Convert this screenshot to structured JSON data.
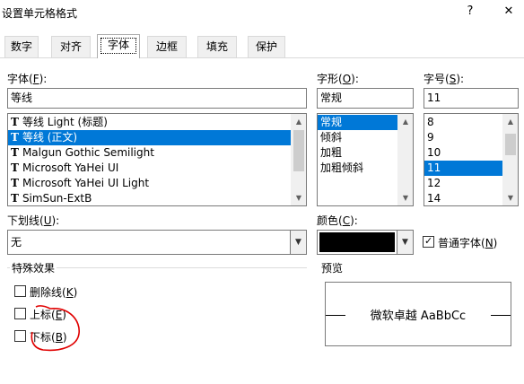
{
  "window": {
    "title": "设置单元格格式",
    "help_label": "?",
    "close_label": "✕"
  },
  "tabs": [
    {
      "label": "数字"
    },
    {
      "label": "对齐"
    },
    {
      "label": "字体"
    },
    {
      "label": "边框"
    },
    {
      "label": "填充"
    },
    {
      "label": "保护"
    }
  ],
  "font": {
    "label_text": "字体(",
    "label_key": "F",
    "label_end": "):",
    "value": "等线",
    "items": [
      {
        "glyph": "T",
        "label": "等线 Light (标题)",
        "selected": false
      },
      {
        "glyph": "T",
        "label": "等线 (正文)",
        "selected": true
      },
      {
        "glyph": "T",
        "label": "Malgun Gothic Semilight",
        "selected": false
      },
      {
        "glyph": "T",
        "label": "Microsoft YaHei UI",
        "selected": false
      },
      {
        "glyph": "T",
        "label": "Microsoft YaHei UI Light",
        "selected": false
      },
      {
        "glyph": "T",
        "label": "SimSun-ExtB",
        "selected": false
      }
    ]
  },
  "style": {
    "label_text": "字形(",
    "label_key": "O",
    "label_end": "):",
    "value": "常规",
    "items": [
      {
        "label": "常规",
        "selected": true
      },
      {
        "label": "倾斜",
        "selected": false
      },
      {
        "label": "加粗",
        "selected": false
      },
      {
        "label": "加粗倾斜",
        "selected": false
      }
    ]
  },
  "size": {
    "label_text": "字号(",
    "label_key": "S",
    "label_end": "):",
    "value": "11",
    "items": [
      {
        "label": "8",
        "selected": false
      },
      {
        "label": "9",
        "selected": false
      },
      {
        "label": "10",
        "selected": false
      },
      {
        "label": "11",
        "selected": true
      },
      {
        "label": "12",
        "selected": false
      },
      {
        "label": "14",
        "selected": false
      }
    ]
  },
  "underline": {
    "label_text": "下划线(",
    "label_key": "U",
    "label_end": "):",
    "value": "无"
  },
  "color": {
    "label_text": "颜色(",
    "label_key": "C",
    "label_end": "):",
    "swatch": "#000000",
    "normal_font_checked": true,
    "normal_font_text": "普通字体(",
    "normal_font_key": "N",
    "normal_font_end": ")"
  },
  "effects": {
    "title": "特殊效果",
    "items": [
      {
        "text": "删除线(",
        "key": "K",
        "end": ")",
        "checked": false
      },
      {
        "text": "上标(",
        "key": "E",
        "end": ")",
        "checked": false
      },
      {
        "text": "下标(",
        "key": "B",
        "end": ")",
        "checked": false
      }
    ]
  },
  "preview": {
    "title": "预览",
    "sample": "微软卓越  AaBbCc"
  },
  "colors": {
    "selection": "#0078d7",
    "annotation": "#e00000"
  }
}
